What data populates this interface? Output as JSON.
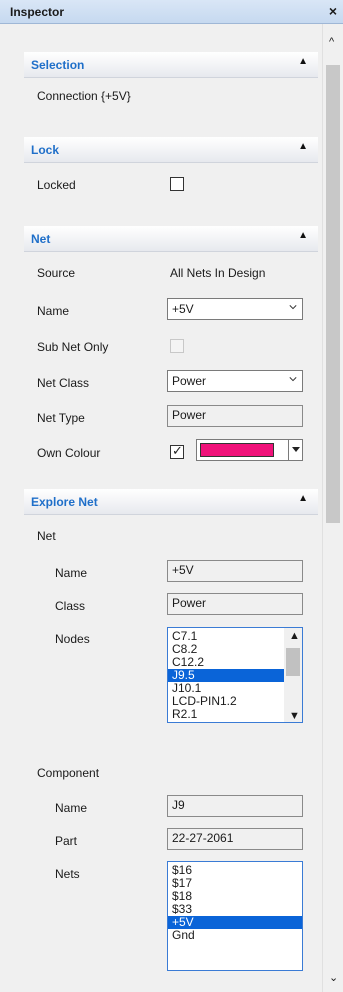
{
  "window": {
    "title": "Inspector",
    "close_glyph": "×"
  },
  "selection": {
    "title": "Selection",
    "value": "Connection {+5V}"
  },
  "lock": {
    "title": "Lock",
    "locked_label": "Locked",
    "locked": false
  },
  "net": {
    "title": "Net",
    "source_label": "Source",
    "source_value": "All Nets In Design",
    "name_label": "Name",
    "name_value": "+5V",
    "subnet_label": "Sub Net Only",
    "subnet_checked": false,
    "netclass_label": "Net Class",
    "netclass_value": "Power",
    "nettype_label": "Net Type",
    "nettype_value": "Power",
    "owncolour_label": "Own Colour",
    "owncolour_checked": true,
    "colour": "#f0127a"
  },
  "explore": {
    "title": "Explore Net",
    "net_heading": "Net",
    "net_name_label": "Name",
    "net_name_value": "+5V",
    "net_class_label": "Class",
    "net_class_value": "Power",
    "nodes_label": "Nodes",
    "nodes": [
      "C7.1",
      "C8.2",
      "C12.2",
      "J9.5",
      "J10.1",
      "LCD-PIN1.2",
      "R2.1"
    ],
    "nodes_selected": "J9.5",
    "component_heading": "Component",
    "comp_name_label": "Name",
    "comp_name_value": "J9",
    "comp_part_label": "Part",
    "comp_part_value": "22-27-2061",
    "comp_nets_label": "Nets",
    "comp_nets": [
      "$16",
      "$17",
      "$18",
      "$33",
      "+5V",
      "Gnd"
    ],
    "comp_nets_selected": "+5V"
  },
  "colors": {
    "accent": "#1f6fc9",
    "selection": "#0a64d8"
  }
}
